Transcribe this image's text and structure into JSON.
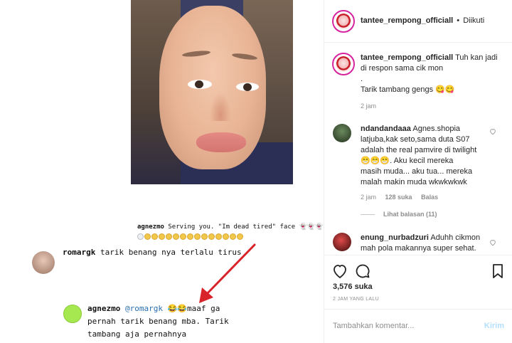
{
  "post": {
    "username": "tantee_rempong_officiall",
    "separator": "•",
    "follow_status": "Diikuti",
    "caption_lines": [
      "Tuh kan jadi",
      "di respon sama cik mon",
      ".",
      "Tarik tambang gengs 😋😋"
    ],
    "caption_time": "2 jam"
  },
  "media": {
    "overlay_top_user": "agnezmo",
    "overlay_top_text": "Serving you. \"Im dead tired\" face 👻👻👻",
    "comment1_user": "romargk",
    "comment1_text": "tarik benang nya terlalu tirus",
    "comment2_user": "agnezmo",
    "comment2_mention": "@romargk",
    "comment2_line1": "😂😂maaf ga",
    "comment2_line2": "pernah tarik benang mba. Tarik",
    "comment2_line3": "tambang aja pernahnya"
  },
  "comments": [
    {
      "user": "ndandandaaa",
      "lines": [
        "Agnes.shopia",
        "latjuba,kak seto,sama duta S07",
        "adalah the real pamvire di twilight",
        "😁😁😁. Aku kecil mereka",
        "masih muda... aku tua... mereka",
        "malah makin muda wkwkwkwk"
      ],
      "time": "2 jam",
      "likes": "128 suka",
      "reply": "Balas",
      "view_replies": "Lihat balasan (11)"
    },
    {
      "user": "enung_nurbadzuri",
      "lines": [
        "Aduhh cikmon",
        "mah pola makannya super sehat."
      ]
    }
  ],
  "stats": {
    "likes": "3,576 suka",
    "posted": "2 JAM YANG LALU"
  },
  "composer": {
    "placeholder": "Tambahkan komentar...",
    "post_label": "Kirim"
  },
  "icons": {
    "like": "heart-icon",
    "comment": "comment-icon",
    "save": "bookmark-icon",
    "more": "more-icon"
  }
}
